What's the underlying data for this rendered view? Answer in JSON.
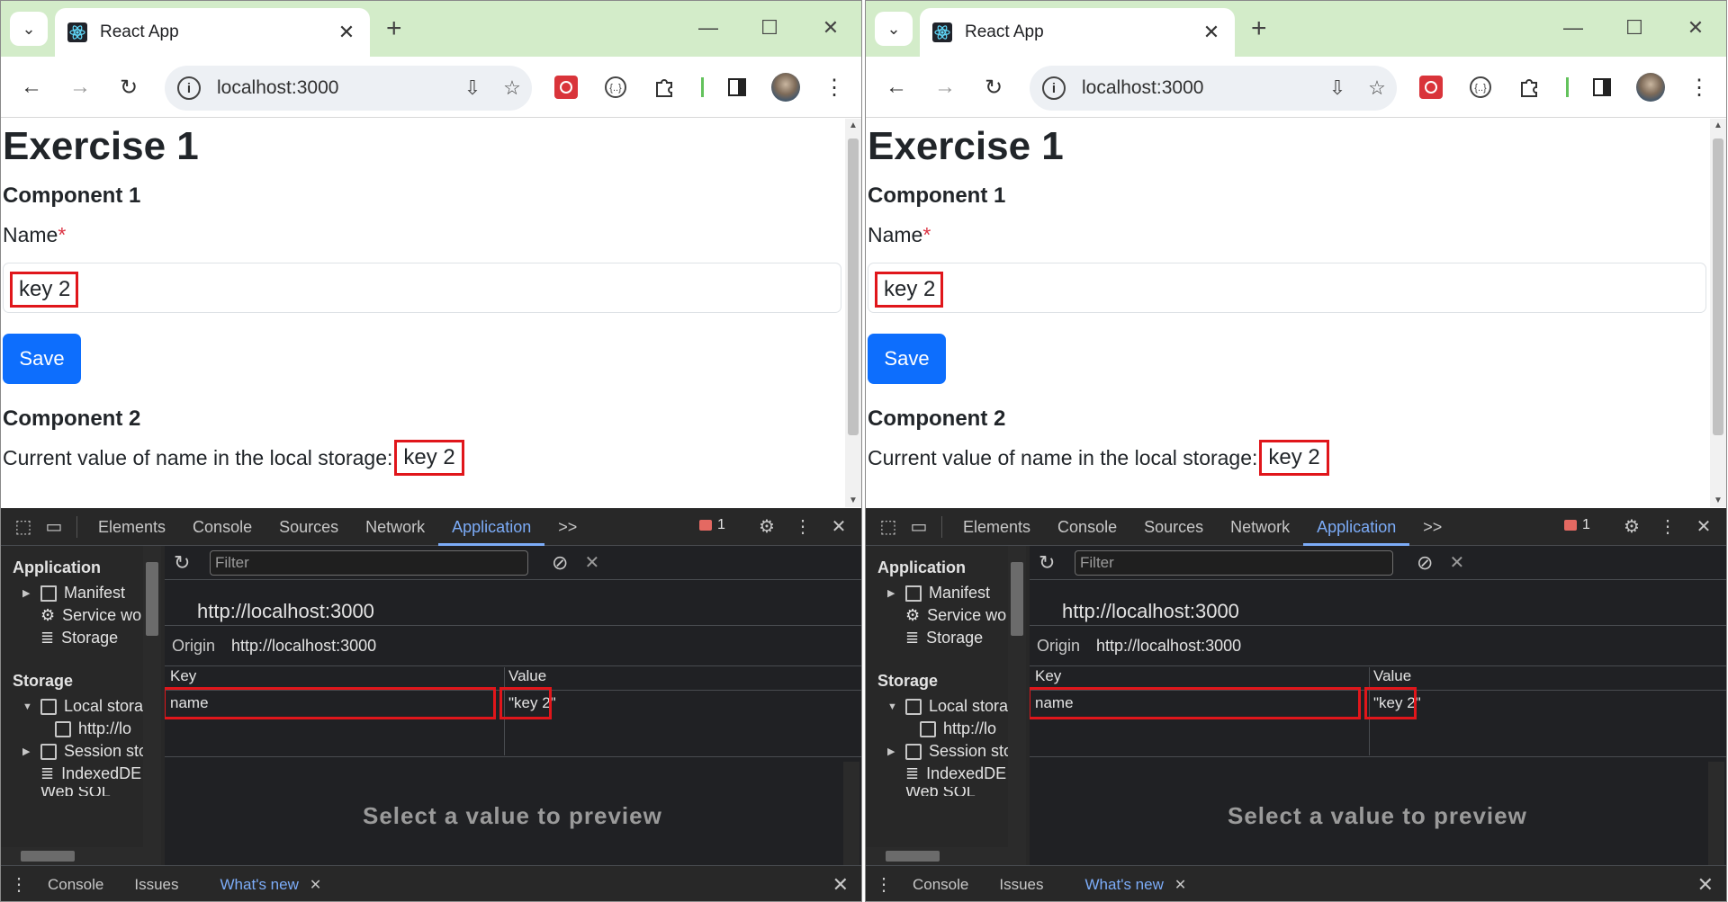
{
  "windows": [
    {
      "tab_title": "React App",
      "url": "localhost:3000",
      "page": {
        "heading": "Exercise 1",
        "component1": "Component 1",
        "name_label": "Name",
        "required_mark": "*",
        "input_value": "key 2",
        "save_button": "Save",
        "component2": "Component 2",
        "current_text": "Current value of name in the local storage:",
        "current_value": "key 2"
      },
      "devtools": {
        "tabs": [
          "Elements",
          "Console",
          "Sources",
          "Network",
          "Application"
        ],
        "more": ">>",
        "issues_count": "1",
        "filter_placeholder": "Filter",
        "sidebar": {
          "app_header": "Application",
          "app_items": [
            "Manifest",
            "Service wo",
            "Storage"
          ],
          "storage_header": "Storage",
          "storage_items": [
            "Local stora",
            "http://lo",
            "Session sto",
            "IndexedDE",
            "Web SQL"
          ]
        },
        "origin_heading": "http://localhost:3000",
        "origin_key": "Origin",
        "origin_value": "http://localhost:3000",
        "table": {
          "key_header": "Key",
          "value_header": "Value",
          "row_key": "name",
          "row_value": "\"key 2\""
        },
        "preview_text": "Select a value to preview",
        "drawer": {
          "console": "Console",
          "issues": "Issues",
          "whats_new": "What's new"
        }
      }
    },
    {
      "tab_title": "React App",
      "url": "localhost:3000",
      "page": {
        "heading": "Exercise 1",
        "component1": "Component 1",
        "name_label": "Name",
        "required_mark": "*",
        "input_value": "key 2",
        "save_button": "Save",
        "component2": "Component 2",
        "current_text": "Current value of name in the local storage:",
        "current_value": "key 2"
      },
      "devtools": {
        "tabs": [
          "Elements",
          "Console",
          "Sources",
          "Network",
          "Application"
        ],
        "more": ">>",
        "issues_count": "1",
        "filter_placeholder": "Filter",
        "sidebar": {
          "app_header": "Application",
          "app_items": [
            "Manifest",
            "Service wo",
            "Storage"
          ],
          "storage_header": "Storage",
          "storage_items": [
            "Local stora",
            "http://lo",
            "Session sto",
            "IndexedDE",
            "Web SQL"
          ]
        },
        "origin_heading": "http://localhost:3000",
        "origin_key": "Origin",
        "origin_value": "http://localhost:3000",
        "table": {
          "key_header": "Key",
          "value_header": "Value",
          "row_key": "name",
          "row_value": "\"key 2\""
        },
        "preview_text": "Select a value to preview",
        "drawer": {
          "console": "Console",
          "issues": "Issues",
          "whats_new": "What's new"
        }
      }
    }
  ],
  "colors": {
    "tabstrip": "#d3ecc9",
    "primary_button": "#0d6efd",
    "highlight_box": "#e0161b",
    "devtools_accent": "#7cacf8"
  }
}
